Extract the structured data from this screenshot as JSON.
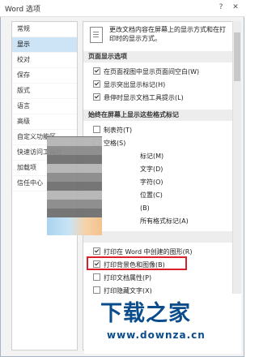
{
  "window": {
    "title": "Word 选项",
    "help": "?",
    "close": "✕"
  },
  "sidebar": {
    "items": [
      {
        "label": "常规"
      },
      {
        "label": "显示",
        "active": true
      },
      {
        "label": "校对"
      },
      {
        "label": "保存"
      },
      {
        "label": "版式"
      },
      {
        "label": "语言"
      },
      {
        "label": "高级"
      },
      {
        "label": "自定义功能区"
      },
      {
        "label": "快速访问工具栏"
      },
      {
        "label": "加载项"
      },
      {
        "label": "信任中心"
      }
    ]
  },
  "content": {
    "intro": "更改文档内容在屏幕上的显示方式和在打印时的显示方式。",
    "page_display": {
      "header": "页面显示选项",
      "options": [
        {
          "label": "在页面视图中显示页面间空白(W)",
          "checked": true
        },
        {
          "label": "显示突出显示标记(H)",
          "checked": true
        },
        {
          "label": "悬停时显示文档工具提示(L)",
          "checked": true
        }
      ]
    },
    "format_marks": {
      "header": "始终在屏幕上显示这些格式标记",
      "options": [
        {
          "label": "制表符(T)",
          "mark": "→",
          "checked": false
        },
        {
          "label": "空格(S)",
          "mark": "···",
          "checked": false
        },
        {
          "label": "标记(M)",
          "mark": "↵",
          "checked": false
        },
        {
          "label": "文字(D)",
          "mark": "abc",
          "checked": false
        },
        {
          "label": "字符(O)",
          "mark": "¬",
          "checked": false
        },
        {
          "label": "位置(C)",
          "mark": "⚓",
          "checked": false
        },
        {
          "label": "(B)",
          "mark": "▯",
          "checked": false
        },
        {
          "label": "所有格式标记(A)",
          "mark": "",
          "checked": false
        }
      ]
    },
    "print": {
      "options": [
        {
          "label": "打印在 Word 中创建的图形(R)",
          "checked": true
        },
        {
          "label": "打印背景色和图像(B)",
          "checked": true
        },
        {
          "label": "打印文档属性(P)",
          "checked": false
        },
        {
          "label": "打印隐藏文字(X)",
          "checked": false
        }
      ]
    }
  },
  "watermark": {
    "logo": "下载之家",
    "url": "www.downza.cn"
  }
}
